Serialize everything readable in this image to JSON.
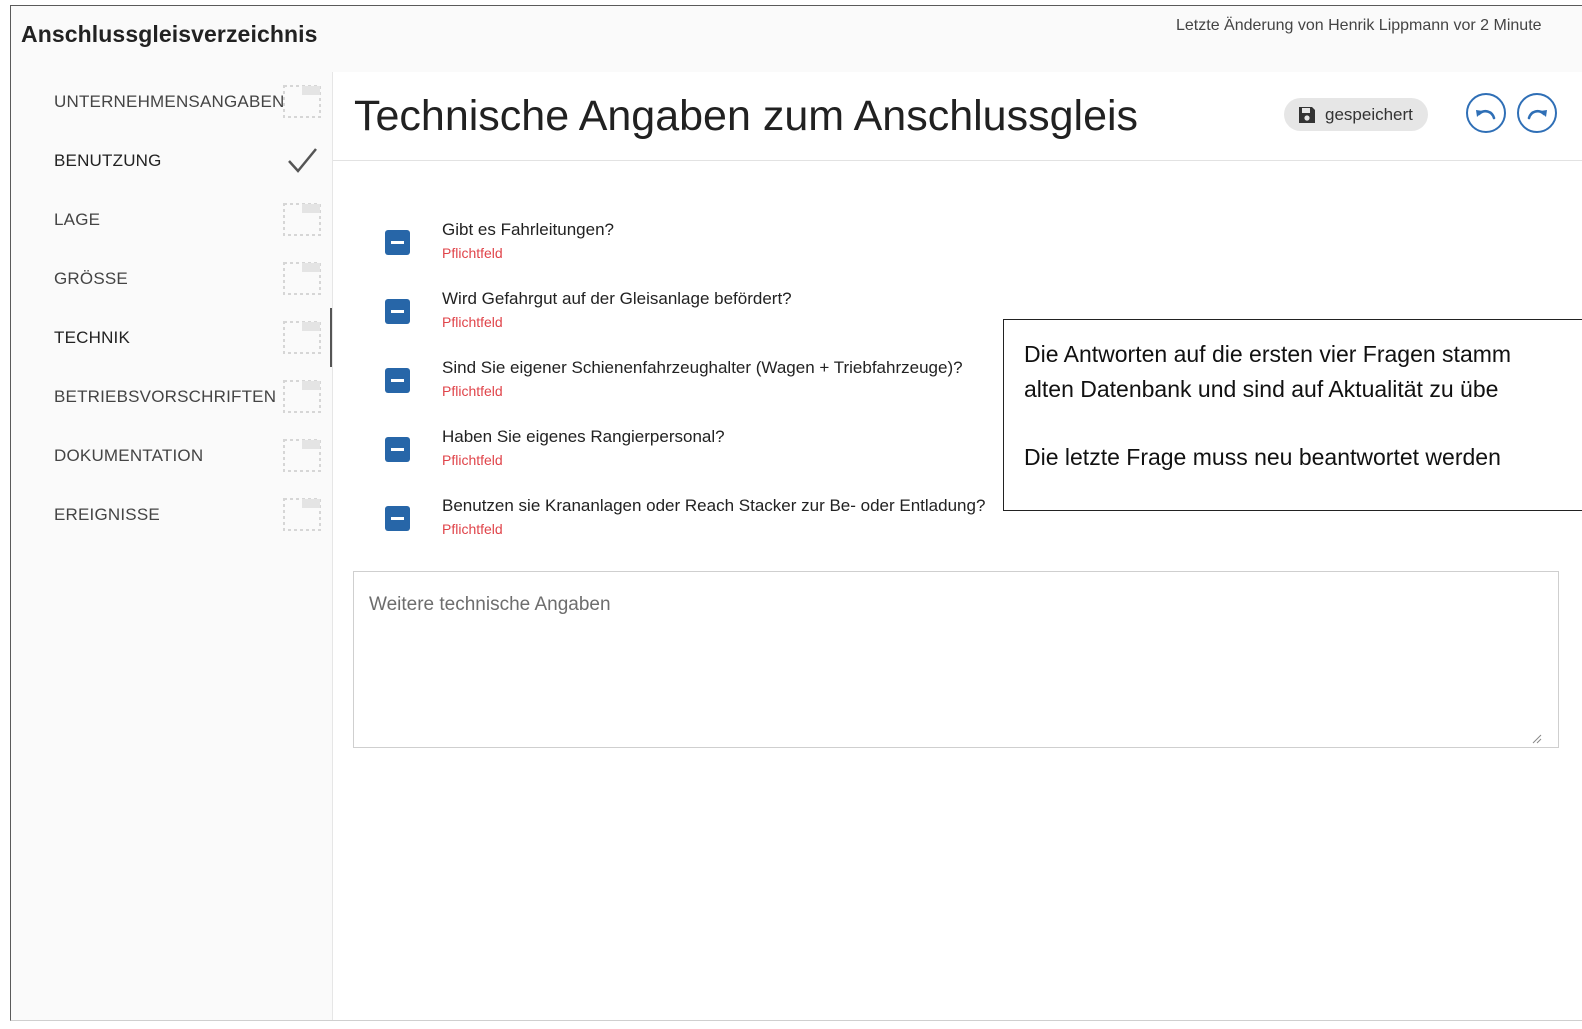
{
  "app": {
    "title": "Anschlussgleisverzeichnis",
    "last_change": "Letzte Änderung von Henrik Lippmann vor 2 Minute"
  },
  "sidebar": {
    "items": [
      {
        "label": "UNTERNEHMENSANGABEN",
        "status": "pending"
      },
      {
        "label": "BENUTZUNG",
        "status": "done"
      },
      {
        "label": "LAGE",
        "status": "pending"
      },
      {
        "label": "GRÖSSE",
        "status": "pending"
      },
      {
        "label": "TECHNIK",
        "status": "active"
      },
      {
        "label": "BETRIEBSVORSCHRIFTEN",
        "status": "pending"
      },
      {
        "label": "DOKUMENTATION",
        "status": "pending"
      },
      {
        "label": "EREIGNISSE",
        "status": "pending"
      }
    ]
  },
  "main": {
    "title": "Technische Angaben zum Anschlussgleis",
    "saved_label": "gespeichert",
    "undo_icon": "undo-icon",
    "redo_icon": "redo-icon",
    "questions": [
      {
        "text": "Gibt es Fahrleitungen?",
        "required": "Pflichtfeld"
      },
      {
        "text": "Wird Gefahrgut auf der Gleisanlage befördert?",
        "required": "Pflichtfeld"
      },
      {
        "text": "Sind Sie eigener Schienenfahrzeughalter (Wagen + Triebfahrzeuge)?",
        "required": "Pflichtfeld"
      },
      {
        "text": "Haben Sie eigenes Rangierpersonal?",
        "required": "Pflichtfeld"
      },
      {
        "text": "Benutzen sie Krananlagen oder Reach Stacker zur Be- oder Entladung?",
        "required": "Pflichtfeld"
      }
    ],
    "note": {
      "line1": "Die Antworten auf die ersten vier Fragen stamm",
      "line2": "alten Datenbank und sind auf Aktualität zu übe",
      "line3": "Die letzte Frage muss neu beantwortet werden"
    },
    "extra_input": {
      "placeholder": "Weitere technische Angaben",
      "value": ""
    }
  },
  "colors": {
    "accent": "#2766a8",
    "required": "#e0444a",
    "badge_bg": "#e6e6e6"
  }
}
